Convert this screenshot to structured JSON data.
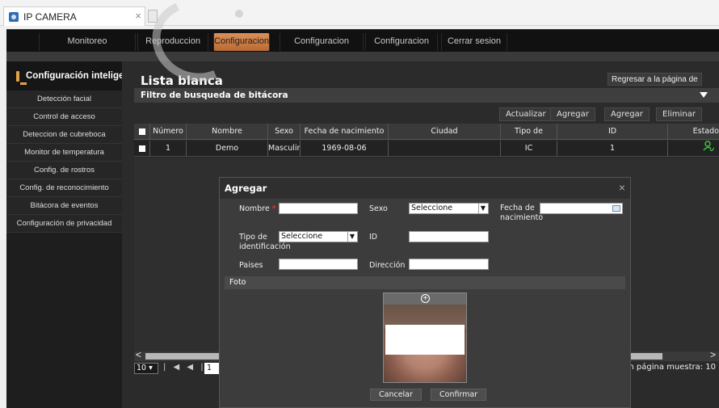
{
  "browser": {
    "tab_title": "IP CAMERA",
    "tab_close": "×"
  },
  "topnav": {
    "items": [
      "Monitoreo",
      "Reproduccion",
      "Configuracion",
      "Configuracion remota",
      "Configuracion local",
      "Cerrar sesion"
    ],
    "active": "Configuracion",
    "active_color": "#c97b45"
  },
  "sidebar": {
    "title": "Configuración inteligente",
    "items": [
      "Detección facial",
      "Control de acceso",
      "Deteccion de cubreboca",
      "Monitor de temperatura",
      "Config. de rostros",
      "Config. de reconocimiento",
      "Bitácora de eventos",
      "Configuración de privacidad"
    ]
  },
  "main": {
    "title": "Lista blanca",
    "back_button": "Regresar a la página de",
    "filter_label": "Filtro de busqueda de bitácora",
    "toolbar": [
      "Actualizar",
      "Agregar",
      "Agregar",
      "Eliminar"
    ]
  },
  "table": {
    "columns": [
      "Número",
      "Nombre",
      "Sexo",
      "Fecha de nacimiento",
      "Ciudad",
      "Tipo de",
      "ID",
      "Estado"
    ],
    "rows": [
      {
        "numero": "1",
        "nombre": "Demo",
        "sexo": "Masculin",
        "fecha": "1969-08-06",
        "ciudad": "",
        "tipo": "IC",
        "id": "1",
        "estado_icon": "user-check-icon"
      }
    ]
  },
  "pager": {
    "page_size": "10",
    "nav": "| ◀ ◀ |",
    "page": "1",
    "info": "n página muestra: 10"
  },
  "modal": {
    "title": "Agregar",
    "close": "×",
    "nombre_label": "Nombre",
    "required_mark": "*",
    "sexo_label": "Sexo",
    "sexo_value": "Seleccione",
    "fecha_label": "Fecha de\nnacimiento",
    "tipo_label": "Tipo de\nidentificación",
    "tipo_value": "Seleccione",
    "id_label": "ID",
    "paises_label": "Paises",
    "direccion_label": "Dirección",
    "foto_label": "Foto",
    "cancel_button": "Cancelar",
    "confirm_button": "Confirmar"
  },
  "colors": {
    "accent": "#c97b45",
    "panel": "#2b2b2b",
    "status_green": "#3cc23c"
  }
}
